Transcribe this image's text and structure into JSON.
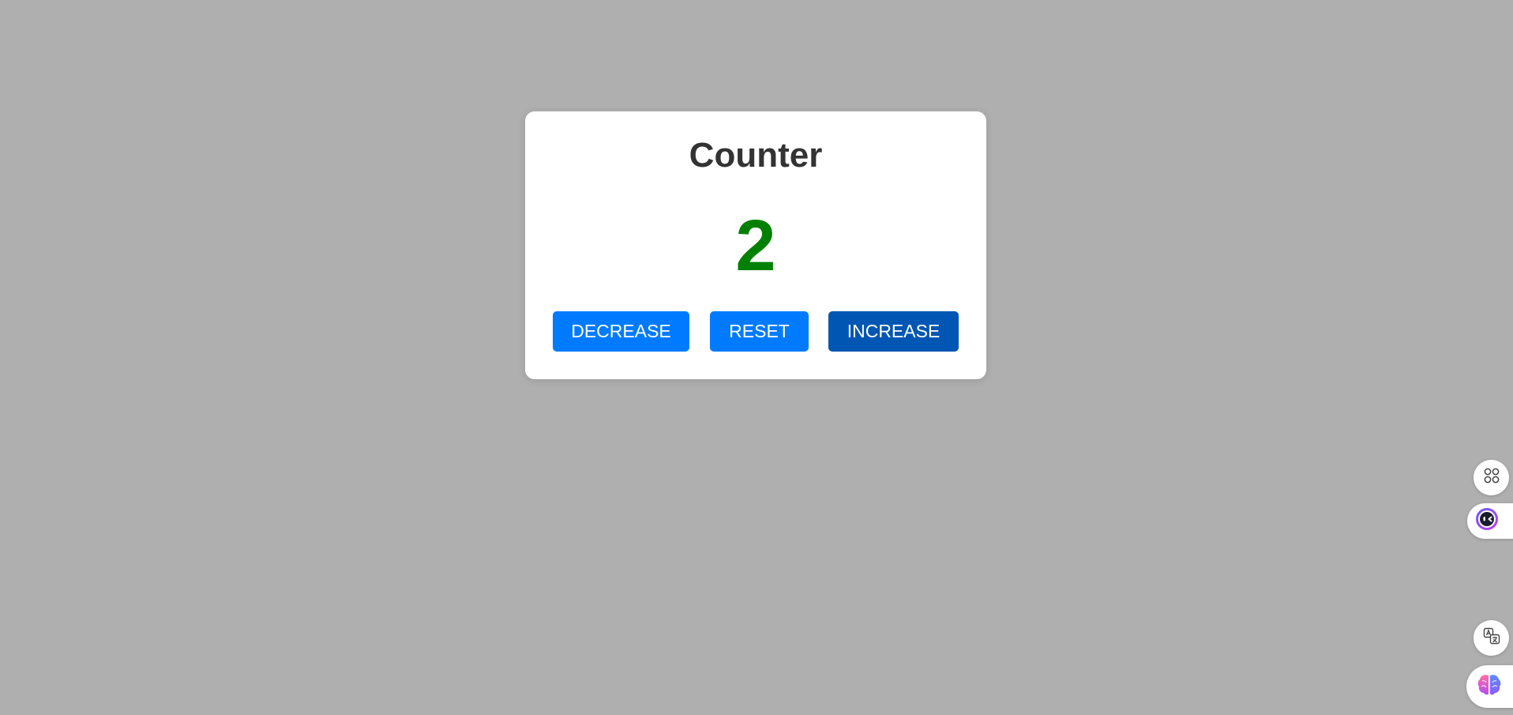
{
  "counter": {
    "title": "Counter",
    "value": "2",
    "value_color": "#008000"
  },
  "buttons": {
    "decrease": {
      "label": "DECREASE",
      "color": "#007bff"
    },
    "reset": {
      "label": "RESET",
      "color": "#007bff"
    },
    "increase": {
      "label": "INCREASE",
      "color": "#0056b3"
    }
  },
  "side_widgets": [
    {
      "icon": "apps-grid-icon"
    },
    {
      "icon": "assistant-face-icon"
    },
    {
      "icon": "translate-icon"
    },
    {
      "icon": "brain-icon"
    }
  ],
  "colors": {
    "background": "#afafaf",
    "card": "#ffffff",
    "title": "#333333"
  }
}
